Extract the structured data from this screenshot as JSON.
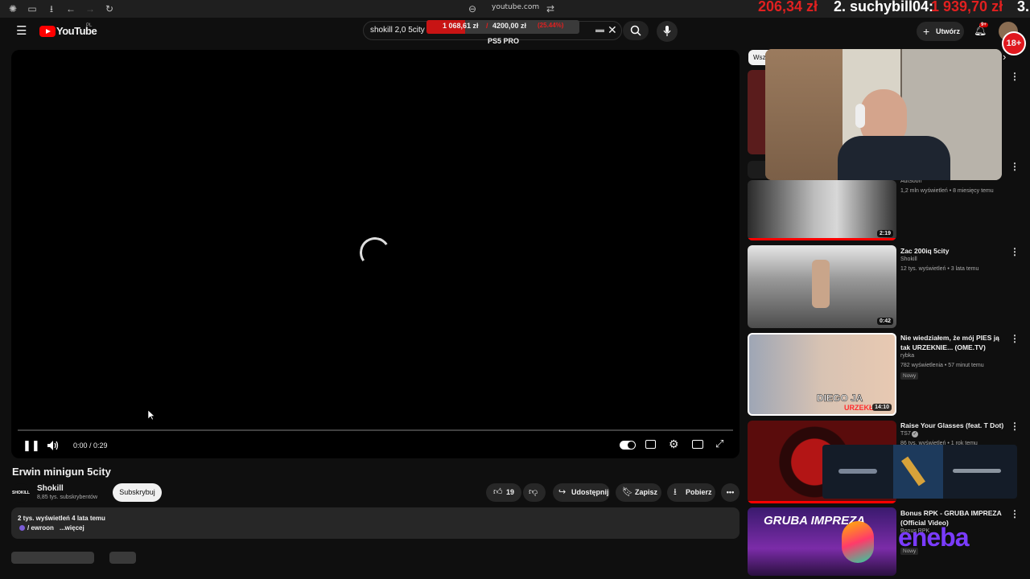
{
  "browser": {
    "url": "youtube.com"
  },
  "stream_overlay": {
    "donation_left_amount": "206,34 zł",
    "donation_rank": "2.",
    "donation_user": "suchybill04:",
    "donation_user_amount": "1 939,70 zł",
    "next_rank": "3.",
    "goal_current": "1 068,61 zł",
    "goal_separator": "/",
    "goal_target": "4200,00 zł",
    "goal_percent": "(25.44%)",
    "goal_title": "PS5 PRO",
    "age_badge": "18+",
    "goal_progress": 0.2544
  },
  "header": {
    "logo_text": "YouTube",
    "logo_region": "PL",
    "search_value": "shokill 2,0 5city",
    "create_label": "Utwórz",
    "notif_count": "9+"
  },
  "player": {
    "time": "0:00 / 0:29",
    "progress": 0.0
  },
  "video": {
    "title": "Erwin minigun 5city",
    "channel": "Shokill",
    "channel_avatar_text": "SHOKILL",
    "subs": "8,85 tys. subskrybentów",
    "subscribe_label": "Subskrybuj",
    "likes": "19",
    "share_label": "Udostępnij",
    "save_label": "Zapisz",
    "download_label": "Pobierz",
    "desc_line1": "2 tys. wyświetleń  4 lata temu",
    "desc_line2": "/ ewroon",
    "desc_more": "...więcej"
  },
  "sidebar": {
    "chip_label": "Wszy",
    "items": [
      {
        "title": "",
        "channel": "AdiSoon",
        "meta": "1,2 mln wyświetleń • 8 miesięcy temu",
        "duration": "2:19",
        "badge": ""
      },
      {
        "title": "Zac 200iq 5city",
        "channel": "Shokill",
        "meta": "12 tys. wyświetleń • 3 lata temu",
        "duration": "0:42",
        "badge": ""
      },
      {
        "title": "Nie wiedziałem, że mój PIES ją tak URZEKNIE... (OME.TV)",
        "channel": "rybka",
        "meta": "782 wyświetlenia • 57 minut temu",
        "duration": "14:10",
        "badge": "Nowy",
        "thumb_text": "DIEGO JA",
        "thumb_text2": "URZEKŁ"
      },
      {
        "title": "Raise Your Glasses (feat. T Dot)",
        "channel": "TS7",
        "meta": "86 tys. wyświetleń • 1 rok temu",
        "duration": "",
        "badge": ""
      },
      {
        "title": "Bonus RPK - GRUBA IMPREZA (Official Video)",
        "channel": "Bonus RPK",
        "meta": "",
        "duration": "",
        "badge": "Nowy",
        "thumb_text": "GRUBA IMPREZA"
      }
    ]
  },
  "overlay_brand": "eneba"
}
